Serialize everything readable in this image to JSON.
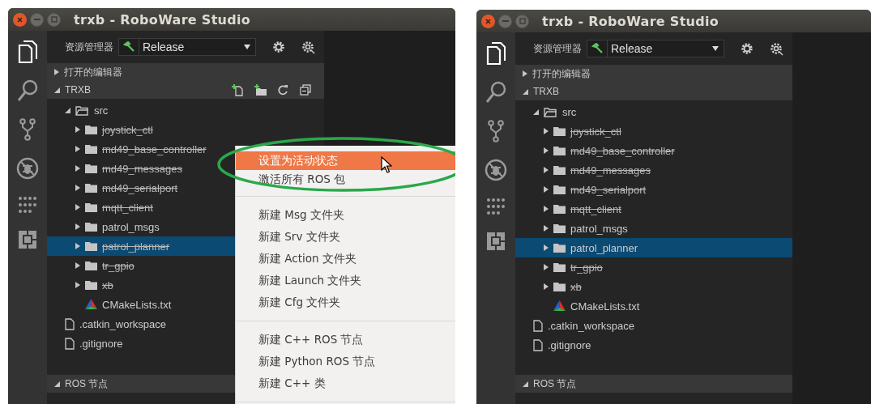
{
  "windows": [
    {
      "title": "trxb - RoboWare Studio",
      "explorer_label": "资源管理器",
      "build_config": "Release",
      "open_editors": {
        "label": "打开的编辑器",
        "expanded": false
      },
      "project": {
        "label": "TRXB",
        "expanded": true,
        "toolbar_visible": true
      },
      "tree": [
        {
          "name": "src",
          "kind": "folder",
          "expanded": true,
          "selected": false,
          "children": [
            {
              "name": "joystick_ctl",
              "kind": "folder",
              "expanded": false,
              "active": false,
              "selected": false
            },
            {
              "name": "md49_base_controller",
              "kind": "folder",
              "expanded": false,
              "active": false,
              "selected": false
            },
            {
              "name": "md49_messages",
              "kind": "folder",
              "expanded": false,
              "active": false,
              "selected": false
            },
            {
              "name": "md49_serialport",
              "kind": "folder",
              "expanded": false,
              "active": false,
              "selected": false
            },
            {
              "name": "mqtt_client",
              "kind": "folder",
              "expanded": false,
              "active": false,
              "selected": false
            },
            {
              "name": "patrol_msgs",
              "kind": "folder",
              "expanded": false,
              "active": true,
              "selected": false
            },
            {
              "name": "patrol_planner",
              "kind": "folder",
              "expanded": false,
              "active": false,
              "selected": true
            },
            {
              "name": "tr_gpio",
              "kind": "folder",
              "expanded": false,
              "active": false,
              "selected": false
            },
            {
              "name": "xb",
              "kind": "folder",
              "expanded": false,
              "active": false,
              "selected": false
            },
            {
              "name": "CMakeLists.txt",
              "kind": "cmake",
              "selected": false
            }
          ]
        },
        {
          "name": ".catkin_workspace",
          "kind": "file",
          "selected": false
        },
        {
          "name": ".gitignore",
          "kind": "file",
          "selected": false
        }
      ],
      "ros_nodes": {
        "label": "ROS 节点",
        "expanded": true
      },
      "context_menu": {
        "groups": [
          [
            {
              "label": "设置为活动状态",
              "selected": true
            },
            {
              "label": "激活所有 ROS 包",
              "selected": false
            }
          ],
          [
            {
              "label": "新建 Msg 文件夹",
              "selected": false
            },
            {
              "label": "新建 Srv 文件夹",
              "selected": false
            },
            {
              "label": "新建 Action 文件夹",
              "selected": false
            },
            {
              "label": "新建 Launch 文件夹",
              "selected": false
            },
            {
              "label": "新建 Cfg 文件夹",
              "selected": false
            }
          ],
          [
            {
              "label": "新建 C++ ROS 节点",
              "selected": false
            },
            {
              "label": "新建 Python ROS 节点",
              "selected": false
            },
            {
              "label": "新建 C++ 类",
              "selected": false
            }
          ]
        ]
      },
      "highlight_ellipse": true,
      "pointer_visible": true
    },
    {
      "title": "trxb - RoboWare Studio",
      "explorer_label": "资源管理器",
      "build_config": "Release",
      "open_editors": {
        "label": "打开的编辑器",
        "expanded": false
      },
      "project": {
        "label": "TRXB",
        "expanded": true,
        "toolbar_visible": false
      },
      "tree": [
        {
          "name": "src",
          "kind": "folder",
          "expanded": true,
          "selected": false,
          "children": [
            {
              "name": "joystick_ctl",
              "kind": "folder",
              "expanded": false,
              "active": false,
              "selected": false
            },
            {
              "name": "md49_base_controller",
              "kind": "folder",
              "expanded": false,
              "active": false,
              "selected": false
            },
            {
              "name": "md49_messages",
              "kind": "folder",
              "expanded": false,
              "active": false,
              "selected": false
            },
            {
              "name": "md49_serialport",
              "kind": "folder",
              "expanded": false,
              "active": false,
              "selected": false
            },
            {
              "name": "mqtt_client",
              "kind": "folder",
              "expanded": false,
              "active": false,
              "selected": false
            },
            {
              "name": "patrol_msgs",
              "kind": "folder",
              "expanded": false,
              "active": true,
              "selected": false
            },
            {
              "name": "patrol_planner",
              "kind": "folder",
              "expanded": false,
              "active": true,
              "selected": true
            },
            {
              "name": "tr_gpio",
              "kind": "folder",
              "expanded": false,
              "active": false,
              "selected": false
            },
            {
              "name": "xb",
              "kind": "folder",
              "expanded": false,
              "active": false,
              "selected": false
            },
            {
              "name": "CMakeLists.txt",
              "kind": "cmake",
              "selected": false
            }
          ]
        },
        {
          "name": ".catkin_workspace",
          "kind": "file",
          "selected": false
        },
        {
          "name": ".gitignore",
          "kind": "file",
          "selected": false
        }
      ],
      "ros_nodes": {
        "label": "ROS 节点",
        "expanded": true
      }
    }
  ]
}
